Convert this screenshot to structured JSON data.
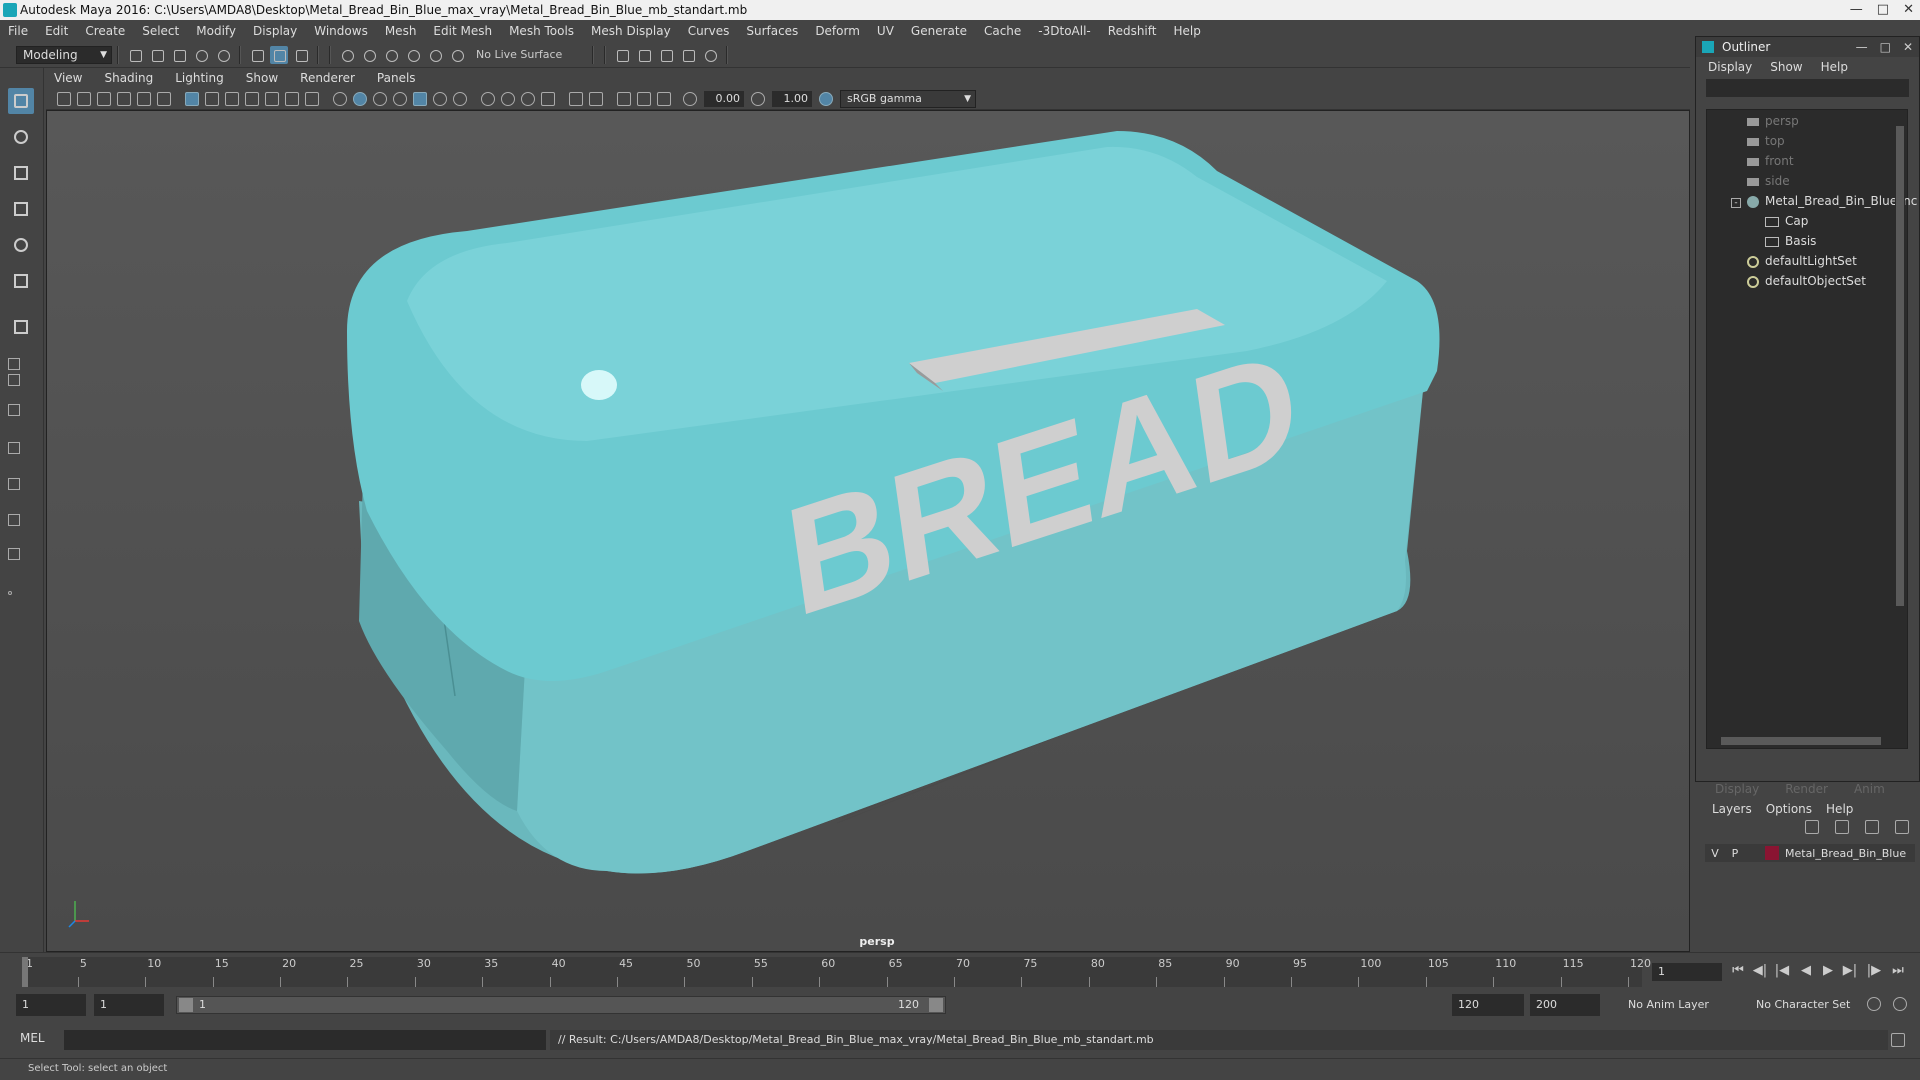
{
  "window": {
    "title": "Autodesk Maya 2016: C:\\Users\\AMDA8\\Desktop\\Metal_Bread_Bin_Blue_max_vray\\Metal_Bread_Bin_Blue_mb_standart.mb"
  },
  "menubar": [
    "File",
    "Edit",
    "Create",
    "Select",
    "Modify",
    "Display",
    "Windows",
    "Mesh",
    "Edit Mesh",
    "Mesh Tools",
    "Mesh Display",
    "Curves",
    "Surfaces",
    "Deform",
    "UV",
    "Generate",
    "Cache",
    "-3DtoAll-",
    "Redshift",
    "Help"
  ],
  "shelf": {
    "mode": "Modeling",
    "live_surface": "No Live Surface"
  },
  "panel": {
    "menus": [
      "View",
      "Shading",
      "Lighting",
      "Show",
      "Renderer",
      "Panels"
    ],
    "exposure": "0.00",
    "gamma": "1.00",
    "colorspace": "sRGB gamma",
    "camera": "persp",
    "model_text": "BREAD",
    "colors": {
      "bin": "#6cc9cf",
      "handle": "#c8c8c8"
    }
  },
  "outliner": {
    "title": "Outliner",
    "menus": [
      "Display",
      "Show",
      "Help"
    ],
    "items": [
      "persp",
      "top",
      "front",
      "side",
      "Metal_Bread_Bin_Blue_nc",
      "Cap",
      "Basis",
      "defaultLightSet",
      "defaultObjectSet"
    ]
  },
  "layers": {
    "tabs": [
      "Display",
      "Render",
      "Anim"
    ],
    "menus": [
      "Layers",
      "Options",
      "Help"
    ],
    "row": {
      "v": "V",
      "p": "P",
      "name": "Metal_Bread_Bin_Blue",
      "color": "#8a1432"
    }
  },
  "timeline": {
    "ticks": [
      "1",
      "5",
      "10",
      "15",
      "20",
      "25",
      "30",
      "35",
      "40",
      "45",
      "50",
      "55",
      "60",
      "65",
      "70",
      "75",
      "80",
      "85",
      "90",
      "95",
      "100",
      "105",
      "110",
      "115",
      "120"
    ],
    "current_frame": "1"
  },
  "range": {
    "start": "1",
    "start2": "1",
    "slider_start": "1",
    "slider_end": "120",
    "end": "120",
    "end2": "200",
    "anim_layer": "No Anim Layer",
    "char_set": "No Character Set"
  },
  "command": {
    "label": "MEL",
    "result": "// Result: C:/Users/AMDA8/Desktop/Metal_Bread_Bin_Blue_max_vray/Metal_Bread_Bin_Blue_mb_standart.mb"
  },
  "status": "Select Tool: select an object"
}
